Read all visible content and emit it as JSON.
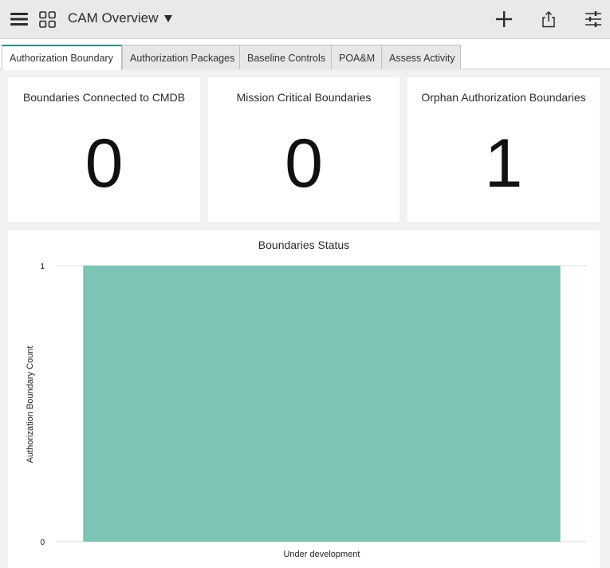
{
  "header": {
    "title": "CAM Overview",
    "icons": [
      "menu-icon",
      "dashboard-grid-icon",
      "dropdown-caret-icon",
      "add-icon",
      "share-icon",
      "filter-settings-icon"
    ]
  },
  "tabs": [
    {
      "label": "Authorization Boundary",
      "active": true
    },
    {
      "label": "Authorization Packages",
      "active": false
    },
    {
      "label": "Baseline Controls",
      "active": false
    },
    {
      "label": "POA&M",
      "active": false
    },
    {
      "label": "Assess Activity",
      "active": false
    }
  ],
  "cards": [
    {
      "title": "Boundaries Connected to CMDB",
      "value": "0"
    },
    {
      "title": "Mission Critical Boundaries",
      "value": "0"
    },
    {
      "title": "Orphan Authorization Boundaries",
      "value": "1"
    }
  ],
  "colors": {
    "bar": "#7cc4b3",
    "active_tab_accent": "#2a8a7e"
  },
  "chart_data": {
    "type": "bar",
    "title": "Boundaries Status",
    "categories": [
      "Under development"
    ],
    "values": [
      1
    ],
    "xlabel": "",
    "ylabel": "Authorization Boundary Count",
    "ylim": [
      0,
      1
    ],
    "yticks": [
      "0",
      "1"
    ],
    "grid": true,
    "legend": "none"
  }
}
